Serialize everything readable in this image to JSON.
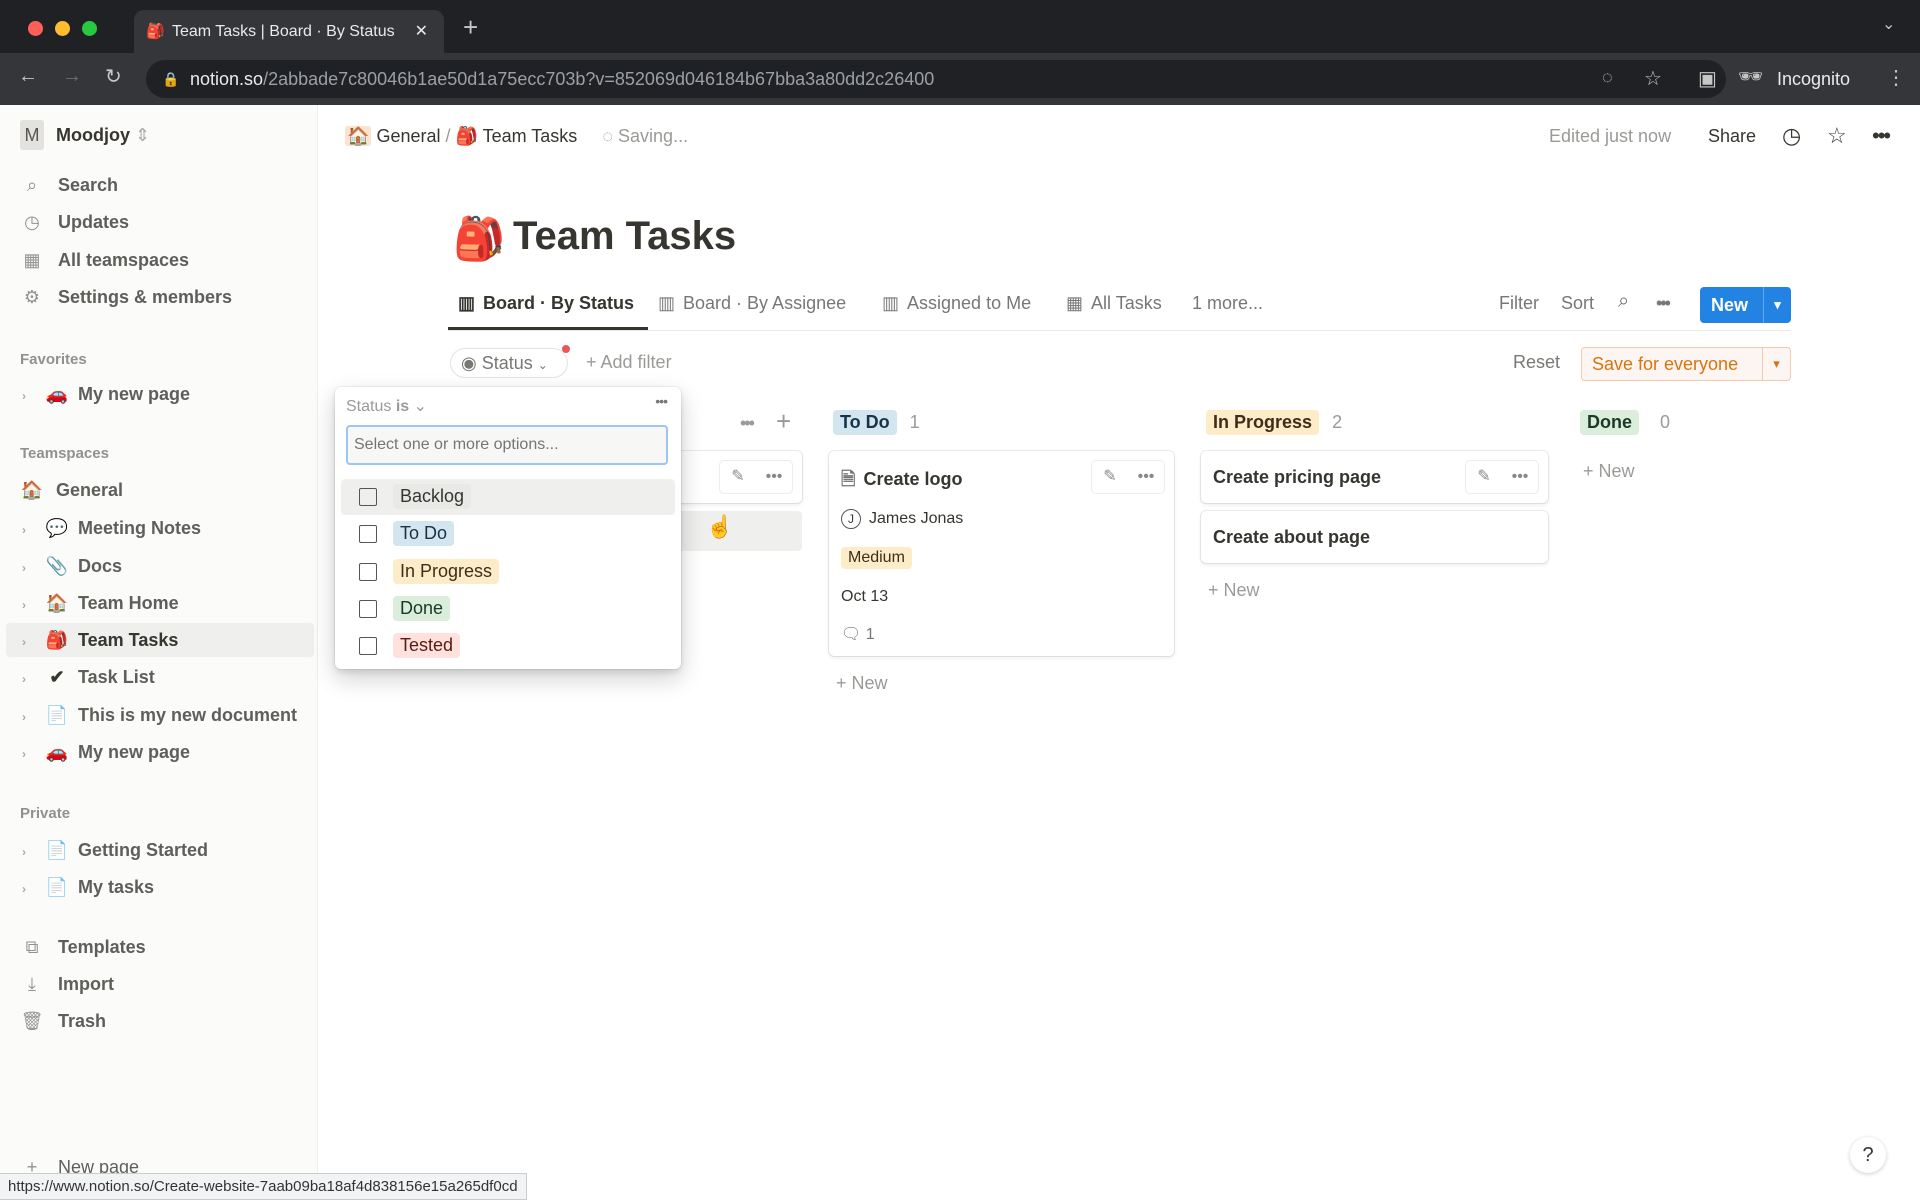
{
  "browser": {
    "tab_title": "Team Tasks | Board · By Status",
    "url_host": "notion.so",
    "url_path": "/2abbade7c80046b1ae50d1a75ecc703b?v=852069d046184b67bba3a80dd2c26400",
    "profile": "Incognito",
    "status_url": "https://www.notion.so/Create-website-7aab09ba18af4d838156e15a265df0cd"
  },
  "workspace": {
    "initial": "M",
    "name": "Moodjoy"
  },
  "sidebar": {
    "top": [
      {
        "label": "Search",
        "icon": "search-icon"
      },
      {
        "label": "Updates",
        "icon": "clock-icon"
      },
      {
        "label": "All teamspaces",
        "icon": "building-icon"
      },
      {
        "label": "Settings & members",
        "icon": "gear-icon"
      }
    ],
    "favorites_label": "Favorites",
    "favorites": [
      {
        "label": "My new page",
        "emoji": "🚗"
      }
    ],
    "teamspaces_label": "Teamspaces",
    "teamspace": {
      "label": "General",
      "emoji": "🏠"
    },
    "teamspace_pages": [
      {
        "label": "Meeting Notes",
        "emoji": "💬"
      },
      {
        "label": "Docs",
        "emoji": "📎"
      },
      {
        "label": "Team Home",
        "emoji": "🏠"
      },
      {
        "label": "Team Tasks",
        "emoji": "🎒"
      },
      {
        "label": "Task List",
        "emoji": "✔"
      },
      {
        "label": "This is my new document",
        "emoji": "📄"
      },
      {
        "label": "My new page",
        "emoji": "🚗"
      }
    ],
    "private_label": "Private",
    "private": [
      {
        "label": "Getting Started",
        "emoji": "📄"
      },
      {
        "label": "My tasks",
        "emoji": "📄"
      }
    ],
    "bottom": [
      {
        "label": "Templates",
        "icon": "templates-icon"
      },
      {
        "label": "Import",
        "icon": "import-icon"
      },
      {
        "label": "Trash",
        "icon": "trash-icon"
      }
    ],
    "new_page": "New page"
  },
  "topbar": {
    "crumbs": [
      "General",
      "Team Tasks"
    ],
    "saving": "Saving...",
    "edited": "Edited just now",
    "share": "Share"
  },
  "page": {
    "title": "Team Tasks",
    "emoji": "🎒"
  },
  "views": [
    "Board · By Status",
    "Board · By Assignee",
    "Assigned to Me",
    "All Tasks",
    "1 more..."
  ],
  "actions": {
    "filter": "Filter",
    "sort": "Sort",
    "new": "New",
    "reset": "Reset",
    "save": "Save for everyone"
  },
  "filters": {
    "status": "Status",
    "add": "Add filter"
  },
  "dropdown": {
    "header": "Status",
    "header_op": "is",
    "placeholder": "Select one or more options...",
    "options": [
      {
        "label": "Backlog",
        "color": "#f1f1ef"
      },
      {
        "label": "To Do",
        "color": "#d3e5ef"
      },
      {
        "label": "In Progress",
        "color": "#fdecc8"
      },
      {
        "label": "Done",
        "color": "#dbeddb"
      },
      {
        "label": "Tested",
        "color": "#ffe2dd"
      }
    ]
  },
  "columns": [
    {
      "label": "To Do",
      "count": "1",
      "color": "#d3e5ef"
    },
    {
      "label": "In Progress",
      "count": "2",
      "color": "#fdecc8"
    },
    {
      "label": "Done",
      "count": "0",
      "color": "#dbeddb"
    }
  ],
  "cards": {
    "todo": {
      "title": "Create logo",
      "assignee": "James Jonas",
      "priority": "Medium",
      "date": "Oct 13",
      "comments": "1"
    },
    "in_progress": [
      "Create pricing page",
      "Create about page"
    ]
  },
  "new_label": "New",
  "accent": "#2383e2"
}
